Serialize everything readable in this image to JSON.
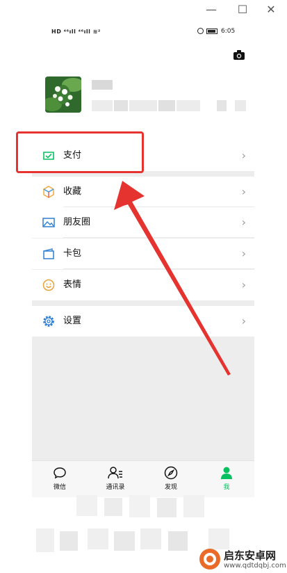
{
  "window": {
    "minimize": "—",
    "maximize": "☐",
    "close": "✕"
  },
  "status_bar": {
    "left_text": "HD ⁴⁶ıll ⁴⁶ıll ≋²",
    "time": "6:05"
  },
  "profile": {
    "camera_icon": "camera-icon"
  },
  "menu": {
    "pay": "支付",
    "favorites": "收藏",
    "moments": "朋友圈",
    "cards": "卡包",
    "stickers": "表情",
    "settings": "设置"
  },
  "tabs": {
    "chats": "微信",
    "contacts": "通讯录",
    "discover": "发现",
    "me": "我"
  },
  "colors": {
    "accent_green": "#07c160",
    "highlight_red": "#e53330"
  },
  "watermark": {
    "name": "启东安卓网",
    "url": "www.qdtdqbj.com"
  }
}
